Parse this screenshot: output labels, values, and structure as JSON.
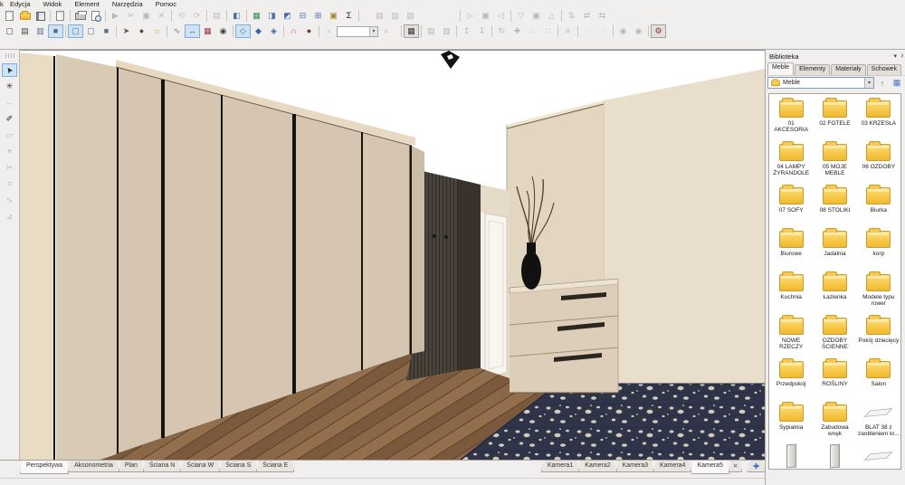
{
  "menubar": {
    "partial": "k",
    "items": [
      "Edycja",
      "Widok",
      "Element",
      "Narzędzia",
      "Pomoc"
    ]
  },
  "toolbar_row1": {
    "buttons": [
      {
        "n": "new-document",
        "c": "page"
      },
      {
        "n": "open-project",
        "c": "folder"
      },
      {
        "n": "save-project",
        "c": "disk"
      },
      {
        "t": "sep"
      },
      {
        "n": "export-file",
        "c": "page"
      },
      {
        "t": "sep"
      },
      {
        "n": "print",
        "c": "printer"
      },
      {
        "n": "print-preview",
        "c": "pagemag"
      },
      {
        "t": "sep"
      },
      {
        "n": "run",
        "g": "▶",
        "s": "dis"
      },
      {
        "n": "cut",
        "g": "✂",
        "s": "dis"
      },
      {
        "n": "copy",
        "g": "▣",
        "s": "dis"
      },
      {
        "n": "delete",
        "g": "✕",
        "s": "dis",
        "col": "#a33535"
      },
      {
        "t": "sep"
      },
      {
        "n": "undo",
        "g": "⟲",
        "s": "dis",
        "col": "#2a7a4a"
      },
      {
        "n": "redo",
        "g": "⟳",
        "s": "dis",
        "col": "#2a7a4a"
      },
      {
        "t": "sep"
      },
      {
        "n": "insert-link",
        "g": "▤",
        "s": "dis"
      },
      {
        "t": "sep"
      },
      {
        "n": "properties-window",
        "g": "◧",
        "col": "#4a6da8"
      },
      {
        "t": "sep"
      },
      {
        "n": "report-window",
        "g": "▦",
        "col": "#2e8b57"
      },
      {
        "n": "price-window",
        "g": "◨",
        "col": "#4a6da8"
      },
      {
        "n": "cutting-window",
        "g": "◩",
        "col": "#4a6da8"
      },
      {
        "n": "list-window",
        "g": "⊟",
        "col": "#4a6da8"
      },
      {
        "n": "new-window",
        "g": "⊞",
        "col": "#4a6da8"
      },
      {
        "n": "summary-window",
        "g": "▣",
        "col": "#a8862e"
      },
      {
        "n": "sum-report",
        "g": "Σ",
        "col": "#1c1c1c"
      },
      {
        "t": "sep"
      },
      {
        "t": "gap",
        "w": 12
      },
      {
        "n": "arrange-a",
        "g": "▤",
        "s": "dis"
      },
      {
        "n": "arrange-b",
        "g": "▥",
        "s": "dis"
      },
      {
        "n": "arrange-c",
        "g": "▧",
        "s": "dis"
      },
      {
        "t": "gap",
        "w": 44
      },
      {
        "t": "sep"
      },
      {
        "n": "align-left",
        "g": "▷",
        "s": "dis"
      },
      {
        "n": "align-center-h",
        "g": "▣",
        "s": "dis"
      },
      {
        "n": "align-right",
        "g": "◁",
        "s": "dis"
      },
      {
        "t": "sep"
      },
      {
        "n": "align-top",
        "g": "▽",
        "s": "dis"
      },
      {
        "n": "align-center-v",
        "g": "▣",
        "s": "dis"
      },
      {
        "n": "align-bottom",
        "g": "△",
        "s": "dis"
      },
      {
        "t": "sep"
      },
      {
        "n": "distribute-h",
        "g": "⇅",
        "s": "dis"
      },
      {
        "n": "distribute-v",
        "g": "⇄",
        "s": "dis"
      },
      {
        "n": "distribute-d",
        "g": "⇆",
        "s": "dis"
      }
    ]
  },
  "toolbar_row2": {
    "buttons": [
      {
        "n": "view-wireframe",
        "g": "▢"
      },
      {
        "n": "view-sketch",
        "g": "▤"
      },
      {
        "n": "view-shaded",
        "g": "▥",
        "col": "#5a6b86"
      },
      {
        "n": "view-textured",
        "g": "■",
        "col": "#5a6b86",
        "s": "sel"
      },
      {
        "t": "sep"
      },
      {
        "n": "view-contour",
        "g": "▢",
        "s": "sel",
        "col": "#5a6b86"
      },
      {
        "n": "view-hidden",
        "g": "▢",
        "col": "#5a6b86"
      },
      {
        "n": "view-solid",
        "g": "■",
        "col": "#5a6b86"
      },
      {
        "t": "sep"
      },
      {
        "n": "drag-mode",
        "g": "➤",
        "col": "#555555"
      },
      {
        "n": "orbit-mode",
        "g": "●",
        "col": "#5a4a3a"
      },
      {
        "n": "light-toggle",
        "g": "☼",
        "col": "#d2a012"
      },
      {
        "t": "sep"
      },
      {
        "n": "materials-toggle",
        "g": "∿",
        "col": "#777777"
      },
      {
        "n": "dimensions-toggle",
        "g": "↔",
        "s": "sel"
      },
      {
        "n": "grid-toggle",
        "g": "▦",
        "col": "#a33535"
      },
      {
        "n": "visibility-toggle",
        "g": "◉",
        "col": "#444444"
      },
      {
        "t": "sep"
      },
      {
        "n": "snap-corner",
        "g": "◇",
        "s": "sel",
        "col": "#3366aa"
      },
      {
        "n": "snap-center",
        "g": "◆",
        "col": "#3366aa"
      },
      {
        "n": "snap-top",
        "g": "◈",
        "col": "#3366aa"
      },
      {
        "t": "sep"
      },
      {
        "n": "magnet-toggle",
        "g": "∩",
        "col": "#b03535"
      },
      {
        "n": "collision-toggle",
        "g": "●",
        "col": "#7a2d2d"
      },
      {
        "t": "sep"
      },
      {
        "n": "zoom-out-tool",
        "g": "⌕",
        "s": "dis"
      },
      {
        "t": "combo",
        "n": "zoom-level-combo"
      },
      {
        "n": "zoom-in-tool",
        "g": "⌕",
        "s": "dis"
      },
      {
        "t": "gap",
        "w": 6
      },
      {
        "t": "sep"
      },
      {
        "n": "pixel-grid-toggle",
        "g": "▦",
        "col": "#333333",
        "s": "on"
      },
      {
        "t": "sep"
      },
      {
        "n": "size-a",
        "g": "▤",
        "s": "dis"
      },
      {
        "n": "size-b",
        "g": "▥",
        "s": "dis"
      },
      {
        "t": "sep"
      },
      {
        "n": "move-up",
        "g": "↥",
        "s": "dis"
      },
      {
        "n": "move-down",
        "g": "↧",
        "s": "dis"
      },
      {
        "t": "sep"
      },
      {
        "n": "rotate",
        "g": "↻",
        "s": "dis"
      },
      {
        "n": "center-element",
        "g": "✚",
        "s": "dis"
      },
      {
        "n": "scatter",
        "g": "∴",
        "s": "dis"
      },
      {
        "n": "pack",
        "g": "∷",
        "s": "dis"
      },
      {
        "t": "sep"
      },
      {
        "n": "flip",
        "g": "≡",
        "s": "dis"
      },
      {
        "t": "sep"
      },
      {
        "n": "shape-a",
        "g": "◌",
        "s": "dis"
      },
      {
        "n": "shape-b",
        "g": "◌",
        "s": "dis"
      },
      {
        "t": "sep"
      },
      {
        "n": "eye-a",
        "g": "◉",
        "s": "dis"
      },
      {
        "n": "eye-b",
        "g": "◉",
        "s": "dis"
      },
      {
        "t": "sep"
      },
      {
        "n": "settings",
        "g": "⚙",
        "col": "#8b3a3a",
        "s": "on"
      }
    ]
  },
  "left_toolbar": {
    "buttons": [
      {
        "n": "select-tool",
        "g": "➤",
        "s": "sel",
        "rot": true,
        "col": "#222222"
      },
      {
        "n": "structure-tool",
        "g": "✳",
        "col": "#333333"
      },
      {
        "n": "dimension-tool",
        "g": "↔",
        "s": "dis"
      },
      {
        "n": "picker-tool",
        "g": "✐",
        "col": "#222222"
      },
      {
        "n": "lasso-tool",
        "g": "▱",
        "s": "dis"
      },
      {
        "n": "node-tool",
        "g": "⌖",
        "s": "dis"
      },
      {
        "n": "split-tool",
        "g": "✂",
        "s": "dis"
      },
      {
        "n": "hatch-tool",
        "g": "⌗",
        "s": "dis"
      },
      {
        "n": "curve-tool",
        "g": "∿",
        "s": "dis"
      },
      {
        "n": "angle-tool",
        "g": "⊿",
        "s": "dis"
      }
    ]
  },
  "library": {
    "title": "Biblioteka",
    "collapse_glyph": "▾",
    "clipped_glyph": "✕",
    "tabs": [
      {
        "label": "Meble",
        "active": true
      },
      {
        "label": "Elementy",
        "active": false
      },
      {
        "label": "Materiały",
        "active": false
      },
      {
        "label": "Schowek",
        "active": false
      }
    ],
    "path_value": "Meble",
    "dropdown_glyph": "▾",
    "up_button_glyph": "↑",
    "view_button_glyph": "▦",
    "items": [
      {
        "label": "01 AKCESORIA",
        "icon": "folder"
      },
      {
        "label": "02 FOTELE",
        "icon": "folder"
      },
      {
        "label": "03 KRZESŁA",
        "icon": "folder"
      },
      {
        "label": "04 LAMPY ŻYRANDOLE",
        "icon": "folder"
      },
      {
        "label": "05 MOJE MEBLE",
        "icon": "folder"
      },
      {
        "label": "06 OZDOBY",
        "icon": "folder"
      },
      {
        "label": "07 SOFY",
        "icon": "folder"
      },
      {
        "label": "08 STOLIKI",
        "icon": "folder"
      },
      {
        "label": "Biurka",
        "icon": "folder"
      },
      {
        "label": "Biurowe",
        "icon": "folder"
      },
      {
        "label": "Jadalnia",
        "icon": "folder"
      },
      {
        "label": "korp",
        "icon": "folder"
      },
      {
        "label": "Kuchnia",
        "icon": "folder"
      },
      {
        "label": "Łazienka",
        "icon": "folder"
      },
      {
        "label": "Modele typu rower",
        "icon": "folder"
      },
      {
        "label": "NOWE RZECZY",
        "icon": "folder"
      },
      {
        "label": "OZDOBY ŚCIENNE",
        "icon": "folder"
      },
      {
        "label": "Pokój dziecięcy",
        "icon": "folder"
      },
      {
        "label": "Przedpokój",
        "icon": "folder"
      },
      {
        "label": "ROŚLINY",
        "icon": "folder"
      },
      {
        "label": "Salon",
        "icon": "folder"
      },
      {
        "label": "Sypialnia",
        "icon": "folder"
      },
      {
        "label": "Zabudowa wnęk",
        "icon": "folder"
      },
      {
        "label": "BLAT 38 z zaobleniem kr...",
        "icon": "flat"
      },
      {
        "label": "",
        "icon": "board"
      },
      {
        "label": "",
        "icon": "board"
      },
      {
        "label": "",
        "icon": "flat"
      }
    ]
  },
  "view_tabs": {
    "tabs": [
      {
        "label": "Perspektywa",
        "active": true
      },
      {
        "label": "Aksonometria",
        "active": false
      },
      {
        "label": "Plan",
        "active": false
      },
      {
        "label": "Ściana N",
        "active": false
      },
      {
        "label": "Ściana W",
        "active": false
      },
      {
        "label": "Ściana S",
        "active": false
      },
      {
        "label": "Ściana E",
        "active": false
      }
    ]
  },
  "camera_tabs": {
    "tabs": [
      {
        "label": "Kamera1",
        "active": false
      },
      {
        "label": "Kamera2",
        "active": false
      },
      {
        "label": "Kamera3",
        "active": false
      },
      {
        "label": "Kamera4",
        "active": false
      },
      {
        "label": "Kamera5",
        "active": true
      }
    ],
    "close_glyph": "✕",
    "add_glyph": "✚"
  },
  "scene": {
    "colors": {
      "ceiling": "#ffffff",
      "wardrobe_side": "#eadcc4",
      "wardrobe_mid": "#d9cab5",
      "wardrobe_face": "#d6c6b1",
      "wardrobe_top": "#e6d8c1",
      "wardrobe_edge": "#6b5f4d",
      "wardrobe_sliver": "#cbbca6",
      "gap_dark": "#17130e",
      "slat_base": "#4a433b",
      "slat_line": "#2f2a24",
      "wall_dark": "#38322b",
      "wall_beige": "#e6dbc8",
      "door_white": "#f7f6f1",
      "door_frame": "#cfccc4",
      "panel_right": "#e3d6c1",
      "panel_bevel": "#f0e4cf",
      "panel_edge": "#b5a78f",
      "wall_right": "#e9decb",
      "corner_line": "#cbbda6",
      "dresser_front": "#dcceb9",
      "dresser_top": "#ece3d3",
      "dresser_line": "#a29179",
      "handle_dark": "#2b2620",
      "floor_a": "#7a593c",
      "floor_b": "#8a6746",
      "floor_c": "#936f4e",
      "floor_line": "#5a412b",
      "rug_base": "#303449",
      "rug_dot": "#d2cbb8",
      "rug_edge": "#23273a",
      "vase": "#111111",
      "twig": "#4b3a27",
      "lamp": "#141414"
    }
  }
}
